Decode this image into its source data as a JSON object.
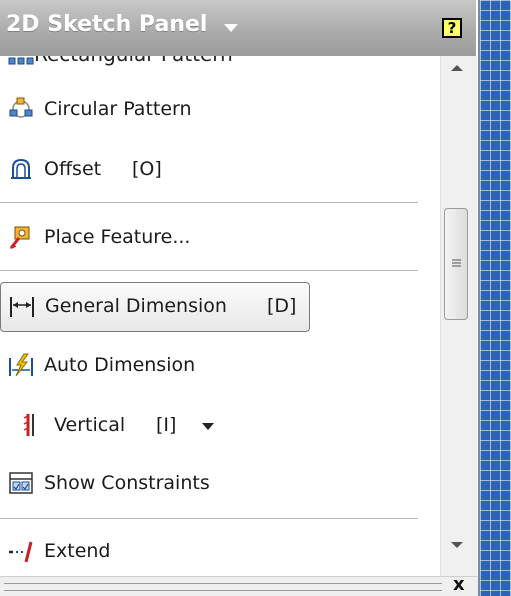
{
  "panel": {
    "title": "2D Sketch Panel",
    "help_label": "?",
    "close_label": "x",
    "peek_item": "Rectangular Pattern"
  },
  "items": [
    {
      "label": "Circular Pattern",
      "icon": "circular-pattern-icon",
      "shortcut": ""
    },
    {
      "label": "Offset",
      "icon": "offset-icon",
      "shortcut": "[O]"
    },
    {
      "label": "Place Feature...",
      "icon": "place-feature-icon",
      "shortcut": ""
    },
    {
      "label": "General Dimension",
      "icon": "general-dimension-icon",
      "shortcut": "[D]"
    },
    {
      "label": "Auto Dimension",
      "icon": "auto-dimension-icon",
      "shortcut": ""
    },
    {
      "label": "Vertical",
      "icon": "vertical-constraint-icon",
      "shortcut": "[I]"
    },
    {
      "label": "Show Constraints",
      "icon": "show-constraints-icon",
      "shortcut": ""
    },
    {
      "label": "Extend",
      "icon": "extend-icon",
      "shortcut": ""
    }
  ],
  "colors": {
    "header": "#a9a9a9",
    "canvas": "#2d63b4",
    "help_button": "#ffff66"
  }
}
